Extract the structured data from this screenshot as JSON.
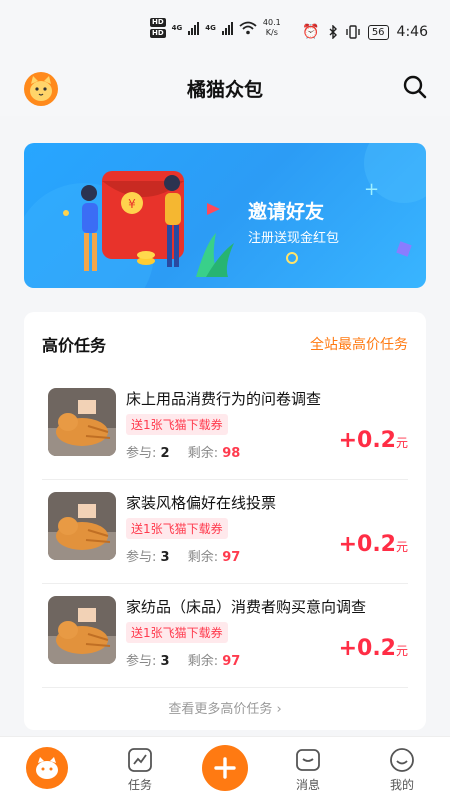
{
  "status_bar": {
    "hd1": "HD",
    "hd2": "HD",
    "net1": "4G",
    "net2": "4G",
    "speed_value": "40.1",
    "speed_unit": "K/s",
    "battery": "56",
    "time": "4:46"
  },
  "header": {
    "title": "橘猫众包",
    "avatar_icon": "cat-icon",
    "search_icon": "search-icon"
  },
  "banner": {
    "title": "邀请好友",
    "subtitle": "注册送现金红包",
    "coin_symbol": "¥"
  },
  "tasks_section": {
    "title": "高价任务",
    "link": "全站最高价任务",
    "items": [
      {
        "name": "床上用品消费行为的问卷调查",
        "coupon": "送1张飞猫下载券",
        "participants_label": "参与:",
        "participants": "2",
        "remaining_label": "剩余:",
        "remaining": "98",
        "reward": "+0.2",
        "unit": "元"
      },
      {
        "name": "家装风格偏好在线投票",
        "coupon": "送1张飞猫下载券",
        "participants_label": "参与:",
        "participants": "3",
        "remaining_label": "剩余:",
        "remaining": "97",
        "reward": "+0.2",
        "unit": "元"
      },
      {
        "name": "家纺品（床品）消费者购买意向调查",
        "coupon": "送1张飞猫下载券",
        "participants_label": "参与:",
        "participants": "3",
        "remaining_label": "剩余:",
        "remaining": "97",
        "reward": "+0.2",
        "unit": "元"
      }
    ],
    "more": "查看更多高价任务"
  },
  "bottom_nav": {
    "tasks": "任务",
    "messages": "消息",
    "mine": "我的"
  },
  "colors": {
    "accent": "#ff7a12",
    "reward": "#ff2d45",
    "banner_blue": "#2c9cf5"
  }
}
